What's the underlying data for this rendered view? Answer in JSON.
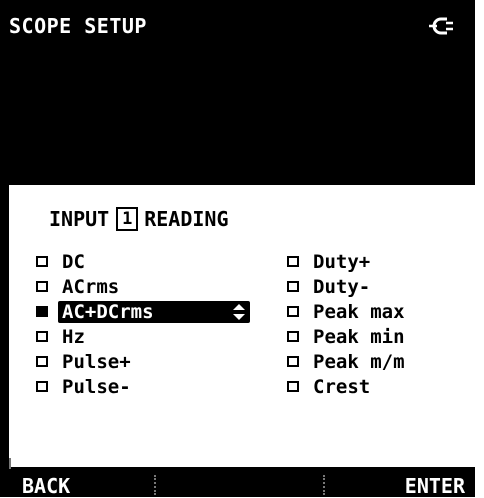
{
  "header": {
    "title": "SCOPE SETUP",
    "power_icon": "plug-icon"
  },
  "dialog": {
    "heading_prefix": "INPUT",
    "input_number": "1",
    "heading_suffix": "READING",
    "left_options": [
      {
        "label": "DC",
        "checked": false
      },
      {
        "label": "ACrms",
        "checked": false
      },
      {
        "label": "AC+DCrms",
        "checked": true,
        "selected": true
      },
      {
        "label": "Hz",
        "checked": false
      },
      {
        "label": "Pulse+",
        "checked": false
      },
      {
        "label": "Pulse-",
        "checked": false
      }
    ],
    "right_options": [
      {
        "label": "Duty+",
        "checked": false
      },
      {
        "label": "Duty-",
        "checked": false
      },
      {
        "label": "Peak max",
        "checked": false
      },
      {
        "label": "Peak min",
        "checked": false
      },
      {
        "label": "Peak m/m",
        "checked": false
      },
      {
        "label": "Crest",
        "checked": false
      }
    ]
  },
  "softkeys": {
    "back_label": "BACK",
    "enter_label": "ENTER"
  }
}
